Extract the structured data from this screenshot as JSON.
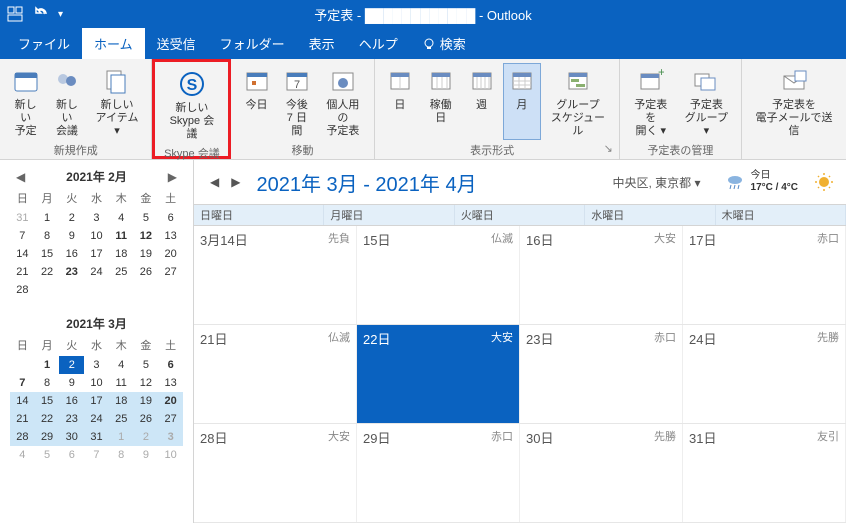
{
  "titlebar": {
    "title": "予定表 - ████████████ - Outlook"
  },
  "menu": {
    "file": "ファイル",
    "home": "ホーム",
    "sendrecv": "送受信",
    "folder": "フォルダー",
    "view": "表示",
    "help": "ヘルプ",
    "search": "検索"
  },
  "ribbon": {
    "group_new": {
      "label": "新規作成",
      "btns": {
        "new_appt": "新しい\n予定",
        "new_meet": "新しい\n会議",
        "new_item": "新しい\nアイテム ▾"
      }
    },
    "group_skype": {
      "label": "Skype 会議",
      "btn": "新しい\nSkype 会議"
    },
    "group_goto": {
      "label": "移動",
      "btns": {
        "today": "今日",
        "next7": "今後\n7 日間",
        "personal": "個人用の\n予定表"
      }
    },
    "group_arrange": {
      "label": "表示形式",
      "btns": {
        "day": "日",
        "workweek": "稼働日",
        "week": "週",
        "month": "月",
        "groupsched": "グループ\nスケジュール"
      }
    },
    "group_manage": {
      "label": "予定表の管理",
      "btns": {
        "open": "予定表を\n開く ▾",
        "groups": "予定表\nグループ ▾"
      }
    },
    "group_share": {
      "label": "",
      "btn": "予定表を\n電子メールで送信"
    }
  },
  "minical1": {
    "title": "2021年 2月",
    "dow": [
      "日",
      "月",
      "火",
      "水",
      "木",
      "金",
      "土"
    ],
    "days": [
      {
        "n": "31",
        "dim": true
      },
      {
        "n": "1"
      },
      {
        "n": "2"
      },
      {
        "n": "3"
      },
      {
        "n": "4"
      },
      {
        "n": "5"
      },
      {
        "n": "6"
      },
      {
        "n": "7"
      },
      {
        "n": "8"
      },
      {
        "n": "9"
      },
      {
        "n": "10"
      },
      {
        "n": "11",
        "b": true
      },
      {
        "n": "12",
        "b": true
      },
      {
        "n": "13"
      },
      {
        "n": "14"
      },
      {
        "n": "15"
      },
      {
        "n": "16"
      },
      {
        "n": "17"
      },
      {
        "n": "18"
      },
      {
        "n": "19"
      },
      {
        "n": "20"
      },
      {
        "n": "21"
      },
      {
        "n": "22"
      },
      {
        "n": "23",
        "b": true
      },
      {
        "n": "24"
      },
      {
        "n": "25"
      },
      {
        "n": "26"
      },
      {
        "n": "27"
      },
      {
        "n": "28"
      }
    ]
  },
  "minical2": {
    "title": "2021年 3月",
    "dow": [
      "日",
      "月",
      "火",
      "水",
      "木",
      "金",
      "土"
    ],
    "days": [
      {
        "n": ""
      },
      {
        "n": "1",
        "b": true
      },
      {
        "n": "2",
        "today": true
      },
      {
        "n": "3"
      },
      {
        "n": "4"
      },
      {
        "n": "5"
      },
      {
        "n": "6",
        "b": true
      },
      {
        "n": "7",
        "b": true
      },
      {
        "n": "8"
      },
      {
        "n": "9"
      },
      {
        "n": "10"
      },
      {
        "n": "11"
      },
      {
        "n": "12"
      },
      {
        "n": "13"
      },
      {
        "n": "14",
        "hl": true
      },
      {
        "n": "15",
        "hl": true
      },
      {
        "n": "16",
        "hl": true
      },
      {
        "n": "17",
        "hl": true
      },
      {
        "n": "18",
        "hl": true
      },
      {
        "n": "19",
        "hl": true
      },
      {
        "n": "20",
        "b": true,
        "hl": true
      },
      {
        "n": "21",
        "hl": true
      },
      {
        "n": "22",
        "hl": true
      },
      {
        "n": "23",
        "hl": true
      },
      {
        "n": "24",
        "hl": true
      },
      {
        "n": "25",
        "hl": true
      },
      {
        "n": "26",
        "hl": true
      },
      {
        "n": "27",
        "hl": true
      },
      {
        "n": "28",
        "hl": true
      },
      {
        "n": "29",
        "hl": true
      },
      {
        "n": "30",
        "hl": true
      },
      {
        "n": "31",
        "hl": true
      },
      {
        "n": "1",
        "dim": true,
        "hl": true
      },
      {
        "n": "2",
        "dim": true,
        "hl": true
      },
      {
        "n": "3",
        "dim": true,
        "b": true,
        "hl": true
      },
      {
        "n": "4",
        "dim": true
      },
      {
        "n": "5",
        "dim": true
      },
      {
        "n": "6",
        "dim": true
      },
      {
        "n": "7",
        "dim": true
      },
      {
        "n": "8",
        "dim": true
      },
      {
        "n": "9",
        "dim": true
      },
      {
        "n": "10",
        "dim": true
      }
    ]
  },
  "calendar": {
    "title": "2021年 3月 - 2021年 4月",
    "location": "中央区, 東京都 ▾",
    "weather": {
      "label": "今日",
      "temp": "17°C / 4°C"
    },
    "dow": [
      "日曜日",
      "月曜日",
      "火曜日",
      "水曜日",
      "木曜日"
    ],
    "weeks": [
      [
        {
          "d": "3月14日",
          "r": "先負"
        },
        {
          "d": "15日",
          "r": "仏滅"
        },
        {
          "d": "16日",
          "r": "大安"
        },
        {
          "d": "17日",
          "r": "赤口"
        }
      ],
      [
        {
          "d": "21日",
          "r": "仏滅"
        },
        {
          "d": "22日",
          "r": "大安",
          "today": true
        },
        {
          "d": "23日",
          "r": "赤口"
        },
        {
          "d": "24日",
          "r": "先勝"
        }
      ],
      [
        {
          "d": "28日",
          "r": "大安"
        },
        {
          "d": "29日",
          "r": "赤口"
        },
        {
          "d": "30日",
          "r": "先勝"
        },
        {
          "d": "31日",
          "r": "友引"
        }
      ]
    ]
  }
}
